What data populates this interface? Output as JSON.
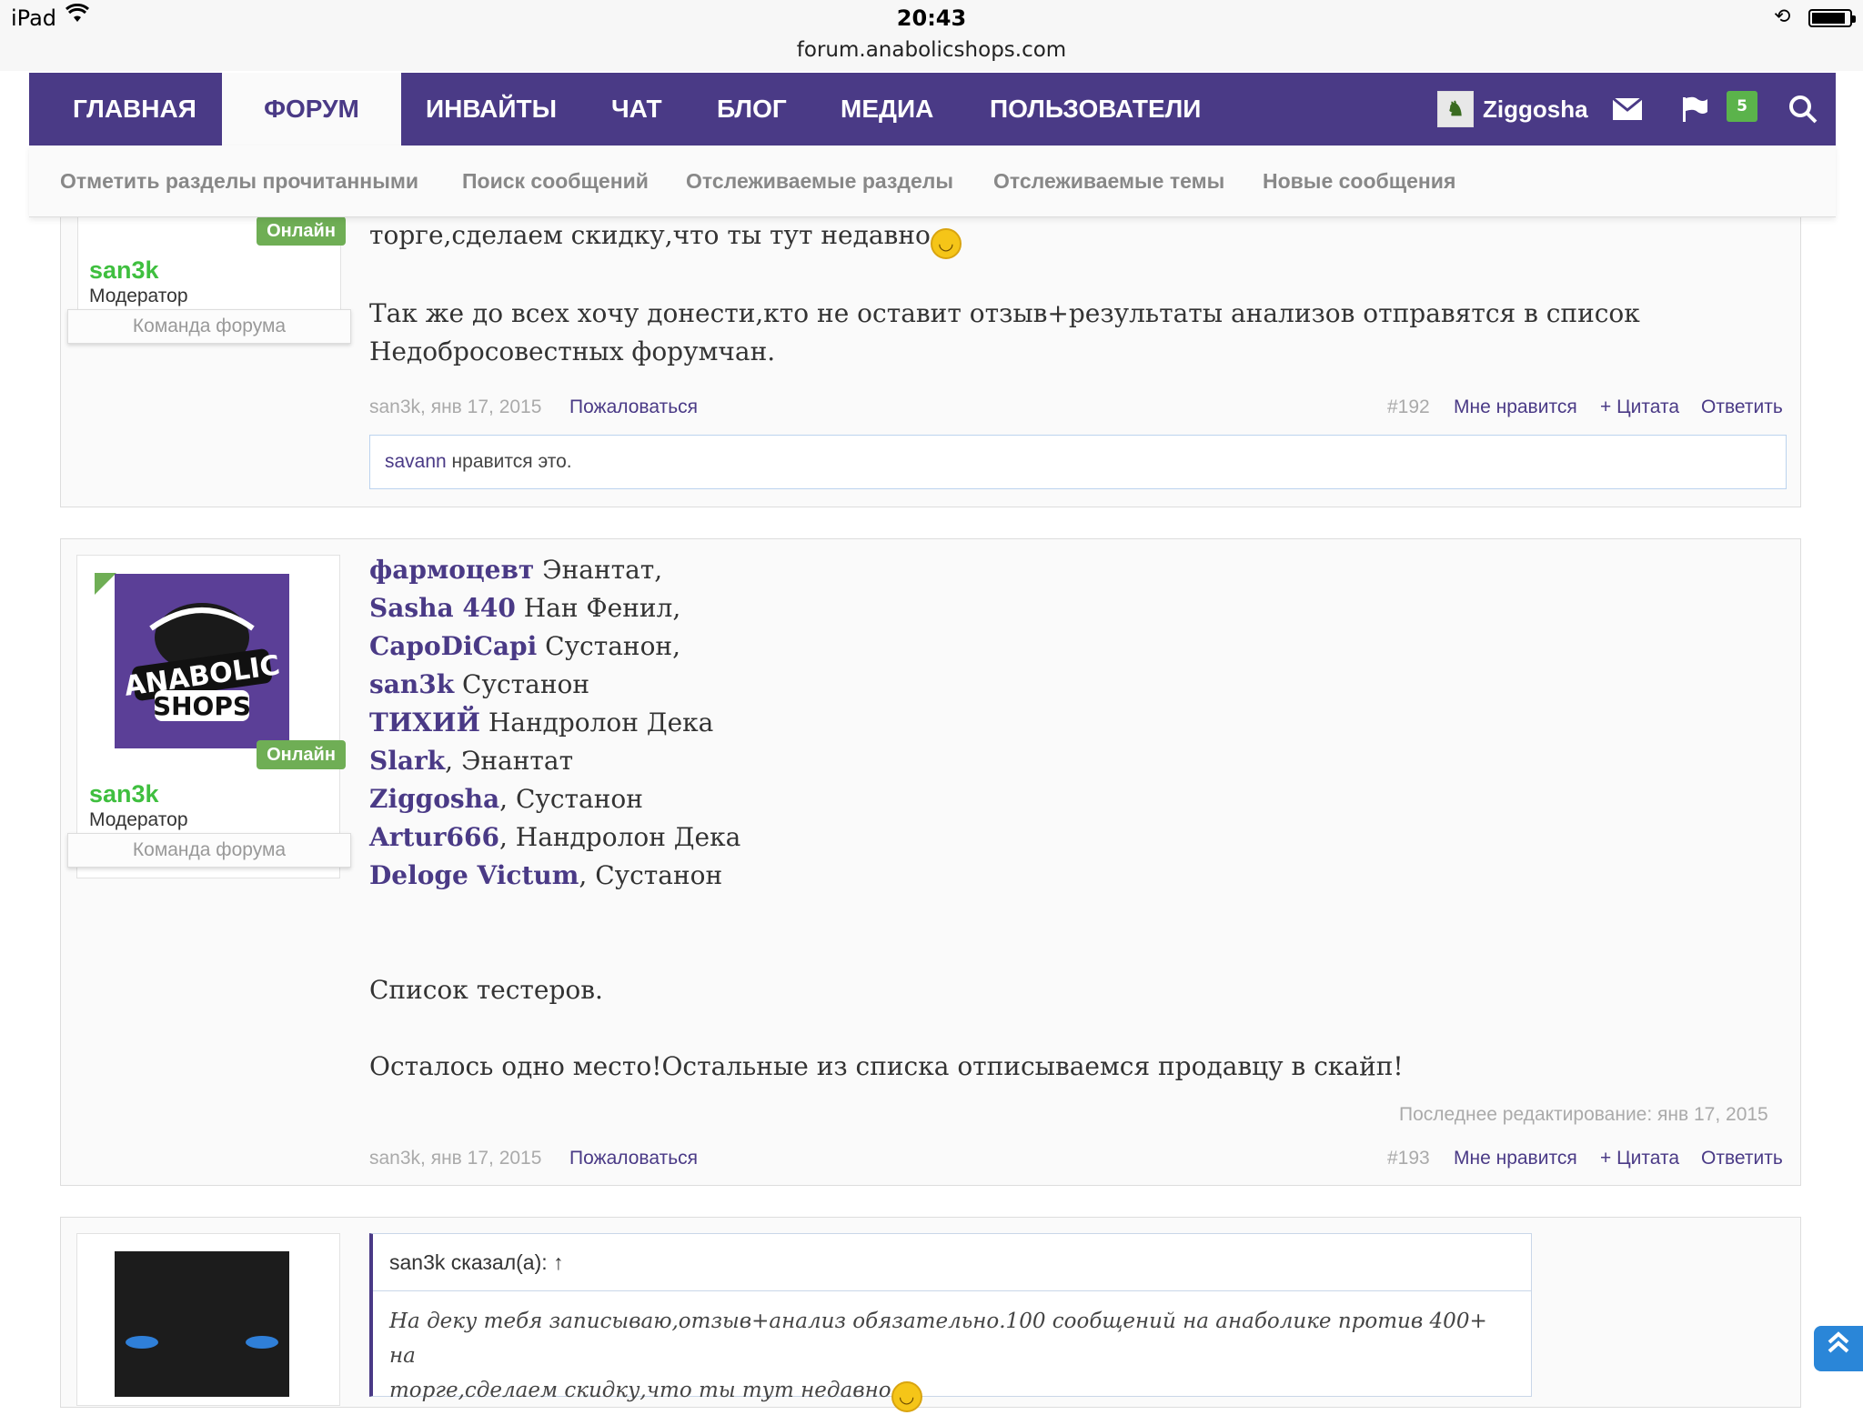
{
  "status_bar": {
    "device": "iPad",
    "time": "20:43",
    "battery_level": 0.9
  },
  "url": "forum.anabolicshops.com",
  "nav": {
    "tabs": [
      {
        "label": "ГЛАВНАЯ"
      },
      {
        "label": "ФОРУМ",
        "active": true
      },
      {
        "label": "ИНВАЙТЫ"
      },
      {
        "label": "ЧАТ"
      },
      {
        "label": "БЛОГ"
      },
      {
        "label": "МЕДИА"
      },
      {
        "label": "ПОЛЬЗОВАТЕЛИ"
      }
    ],
    "username": "Ziggosha",
    "alerts_count": "5",
    "icons": [
      "envelope-icon",
      "flag-icon",
      "search-icon"
    ]
  },
  "subnav": [
    "Отметить разделы прочитанными",
    "Поиск сообщений",
    "Отслеживаемые разделы",
    "Отслеживаемые темы",
    "Новые сообщения"
  ],
  "post1": {
    "online": "Онлайн",
    "author": "san3k",
    "role": "Модератор",
    "banner": "Команда форума",
    "text_top": "торге,сделаем скидку,что ты тут недавно",
    "text_line1": "Так же до всех хочу донести,кто не оставит отзыв+результаты анализов отправятся в список",
    "text_line2": "Недобросовестных форумчан.",
    "meta_author_date": "san3k, янв 17, 2015",
    "report": "Пожаловаться",
    "number": "#192",
    "like": "Мне нравится",
    "quote": "+ Цитата",
    "reply": "Ответить",
    "likes_user": "savann",
    "likes_text": " нравится это."
  },
  "post2": {
    "online": "Онлайн",
    "author": "san3k",
    "role": "Модератор",
    "banner": "Команда форума",
    "testers": [
      {
        "name": "фармоцевт",
        "item": " Энантат,"
      },
      {
        "name": "Sasha 440",
        "item": " Нан Фенил,"
      },
      {
        "name": "CapoDiCapi",
        "item": " Сустанон,"
      },
      {
        "name": "san3k",
        "item": " Сустанон"
      },
      {
        "name": "ТИХИЙ",
        "item": " Нандролон Дека"
      },
      {
        "name": "Slark",
        "item": ", Энантат"
      },
      {
        "name": "Ziggosha",
        "item": ", Сустанон"
      },
      {
        "name": "Artur666",
        "item": ", Нандролон Дека"
      },
      {
        "name": "Deloge Victum",
        "item": ", Сустанон"
      }
    ],
    "list_title": "Список тестеров.",
    "note": "Осталось одно место!Остальные из списка отписываемся продавцу в скайп!",
    "last_edit": "Последнее редактирование: янв 17, 2015",
    "meta_author_date": "san3k, янв 17, 2015",
    "report": "Пожаловаться",
    "number": "#193",
    "like": "Мне нравится",
    "quote": "+ Цитата",
    "reply": "Ответить"
  },
  "post3": {
    "quote_head": "san3k сказал(а): ↑",
    "quote_line1": "На деку тебя записываю,отзыв+анализ обязательно.100 сообщений на анаболике против 400+ на",
    "quote_line2": "торге,сделаем скидку,что ты тут недавно"
  },
  "avatar_logo": {
    "line1": "ANABOLIC",
    "line2": "SHOPS"
  },
  "colors": {
    "brand": "#4a3a86",
    "online": "#6fae55",
    "username": "#3fbf3f"
  }
}
